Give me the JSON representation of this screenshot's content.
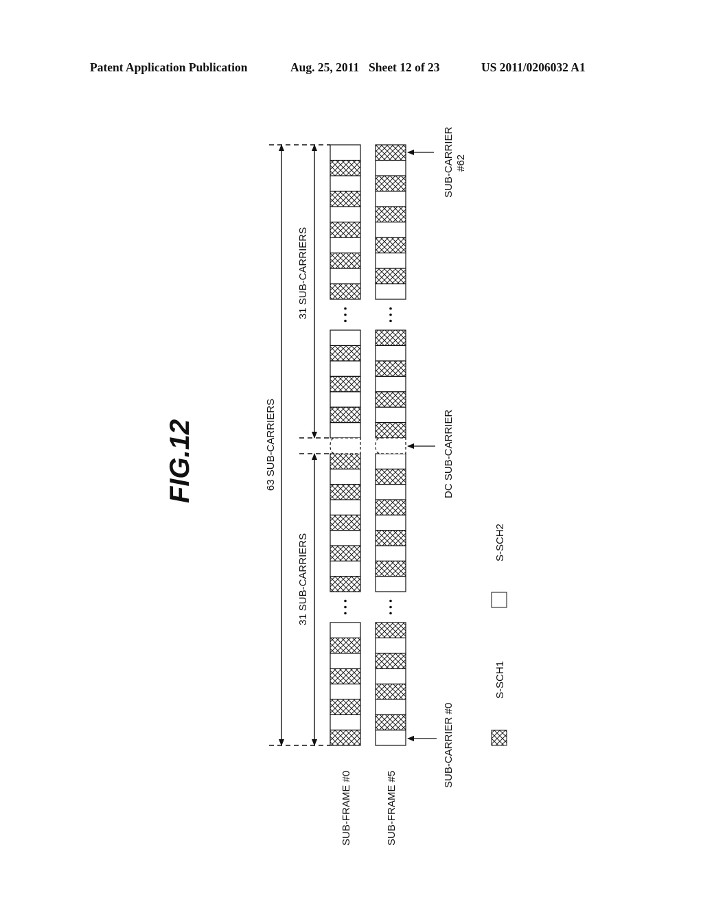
{
  "header": {
    "left": "Patent Application Publication",
    "date": "Aug. 25, 2011",
    "sheet": "Sheet 12 of 23",
    "pub_number": "US 2011/0206032 A1"
  },
  "figure": {
    "title": "FIG.12",
    "total_span_label": "63 SUB-CARRIERS",
    "upper_half_label": "31 SUB-CARRIERS",
    "lower_half_label": "31 SUB-CARRIERS",
    "rows": [
      {
        "label": "SUB-FRAME #0",
        "segments": [
          [
            "S-SCH1",
            "S-SCH2",
            "S-SCH1",
            "S-SCH2",
            "S-SCH1",
            "S-SCH2",
            "S-SCH1",
            "S-SCH2"
          ],
          [
            "S-SCH1",
            "S-SCH2",
            "S-SCH1",
            "S-SCH2",
            "S-SCH1",
            "S-SCH2",
            "S-SCH1",
            "S-SCH2",
            "S-SCH1"
          ],
          [
            "S-SCH2",
            "S-SCH1",
            "S-SCH2",
            "S-SCH1",
            "S-SCH2",
            "S-SCH1",
            "S-SCH2"
          ],
          [
            "S-SCH1",
            "S-SCH2",
            "S-SCH1",
            "S-SCH2",
            "S-SCH1",
            "S-SCH2",
            "S-SCH1",
            "S-SCH2",
            "S-SCH1",
            "S-SCH2"
          ]
        ]
      },
      {
        "label": "SUB-FRAME #5",
        "segments": [
          [
            "S-SCH2",
            "S-SCH1",
            "S-SCH2",
            "S-SCH1",
            "S-SCH2",
            "S-SCH1",
            "S-SCH2",
            "S-SCH1"
          ],
          [
            "S-SCH2",
            "S-SCH1",
            "S-SCH2",
            "S-SCH1",
            "S-SCH2",
            "S-SCH1",
            "S-SCH2",
            "S-SCH1",
            "S-SCH2"
          ],
          [
            "S-SCH1",
            "S-SCH2",
            "S-SCH1",
            "S-SCH2",
            "S-SCH1",
            "S-SCH2",
            "S-SCH1"
          ],
          [
            "S-SCH2",
            "S-SCH1",
            "S-SCH2",
            "S-SCH1",
            "S-SCH2",
            "S-SCH1",
            "S-SCH2",
            "S-SCH1",
            "S-SCH2",
            "S-SCH1"
          ]
        ]
      }
    ],
    "ellipsis": "⋮",
    "annotations": {
      "first_subcarrier": "SUB-CARRIER #0",
      "dc_subcarrier": "DC SUB-CARRIER",
      "last_subcarrier_line1": "SUB-CARRIER",
      "last_subcarrier_line2": "#62"
    },
    "legend": [
      {
        "pattern": "hatched",
        "label": "S-SCH1"
      },
      {
        "pattern": "blank",
        "label": "S-SCH2"
      }
    ]
  }
}
